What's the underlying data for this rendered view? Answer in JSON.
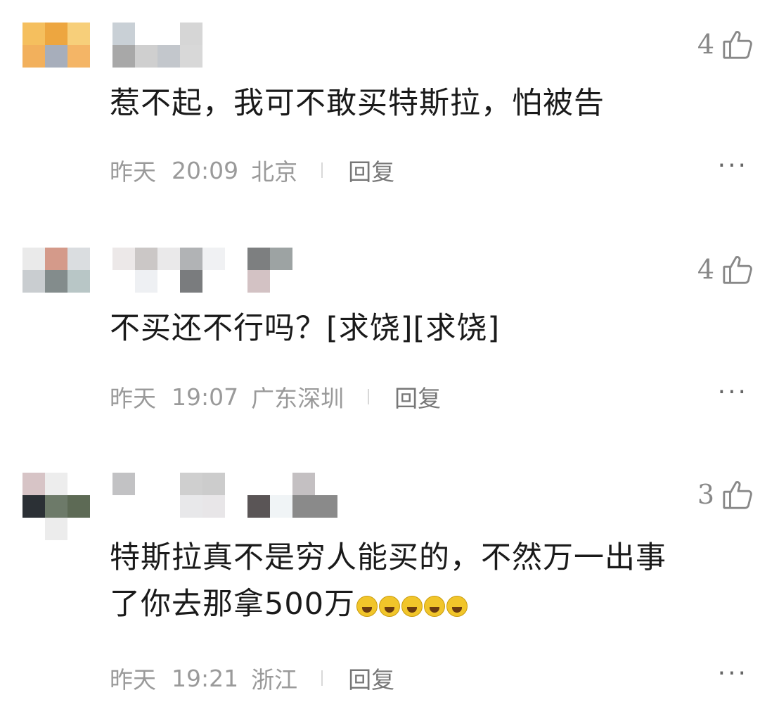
{
  "colors": {
    "text": "#1a1a1a",
    "meta": "#9a9a9a",
    "like": "#888888",
    "emoji": "#f1c52a"
  },
  "comments": [
    {
      "likes": "4",
      "text": "惹不起，我可不敢买特斯拉，怕被告",
      "day": "昨天",
      "time": "20:09",
      "location": "北京",
      "reply": "回复",
      "more": "···",
      "avatar_colors": [
        "#f5bf5e",
        "#eda640",
        "#f7cf7a",
        "#f2b05c",
        "#a7aebb",
        "#f4b566"
      ],
      "name_colors": [
        "#c9d0d6",
        "#ffffff",
        "#ffffff",
        "#d6d6d6",
        "#a8a8a8",
        "#cfcfcf",
        "#c3c7cc",
        "#d8d8d8"
      ]
    },
    {
      "likes": "4",
      "text": "不买还不行吗？[求饶][求饶]",
      "day": "昨天",
      "time": "19:07",
      "location": "广东深圳",
      "reply": "回复",
      "more": "···",
      "avatar_colors": [
        "#eaeaea",
        "#d49a8a",
        "#dadde0",
        "#c9cdd0",
        "#838c8c",
        "#b8c6c6"
      ],
      "name_colors": [
        "#ece8e8",
        "#cbc7c6",
        "#eae9ea",
        "#b1b3b5",
        "#f5f5f6",
        "#7d7f80",
        "#9da3a3",
        "#d3c2c4"
      ]
    },
    {
      "likes": "3",
      "text_line1": "特斯拉真不是穷人能买的，不然万一出事",
      "text_line2": "了你去那拿500万",
      "emoji": "laughing-crying-emoji",
      "emoji_count": 5,
      "day": "昨天",
      "time": "19:21",
      "location": "浙江",
      "reply": "回复",
      "more": "···",
      "avatar_colors": [
        "#d7c4c6",
        "#ededed",
        "#ffffff",
        "#2b3035",
        "#6d7a69",
        "#5d6a55"
      ],
      "name_colors": [
        "#c2c2c4",
        "#cfcfcf",
        "#cccccc",
        "#c4c0c2",
        "#e8e8ea",
        "#e8e6e8",
        "#5a5556",
        "#8a8a8a"
      ]
    }
  ]
}
